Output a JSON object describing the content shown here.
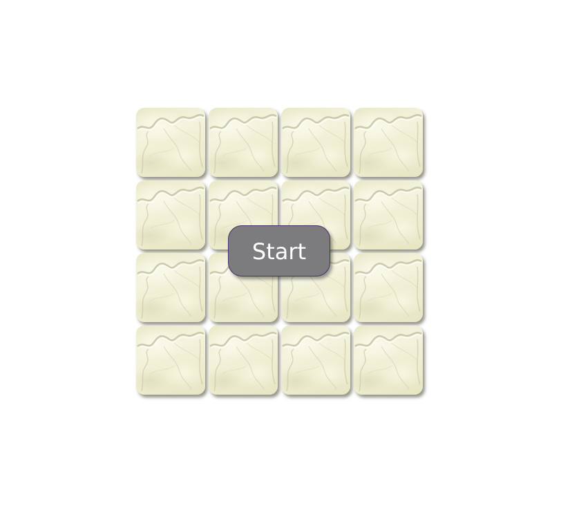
{
  "game": {
    "grid_rows": 4,
    "grid_cols": 4,
    "tile_count": 16,
    "tile_state": "face-down"
  },
  "start_button": {
    "label": "Start"
  },
  "colors": {
    "background": "#ffffff",
    "tile_base": "#efeed2",
    "button_fill": "#7c7b7e",
    "button_border": "#4a2f6a",
    "button_text": "#ffffff"
  }
}
